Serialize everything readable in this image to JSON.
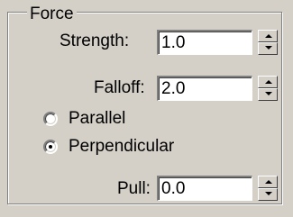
{
  "group": {
    "title": "Force"
  },
  "strength": {
    "label": "Strength:",
    "value": "1.0"
  },
  "falloff": {
    "label": "Falloff:",
    "value": "2.0"
  },
  "direction": {
    "options": [
      {
        "label": "Parallel",
        "selected": false
      },
      {
        "label": "Perpendicular",
        "selected": true
      }
    ]
  },
  "pull": {
    "label": "Pull:",
    "value": "0.0"
  }
}
